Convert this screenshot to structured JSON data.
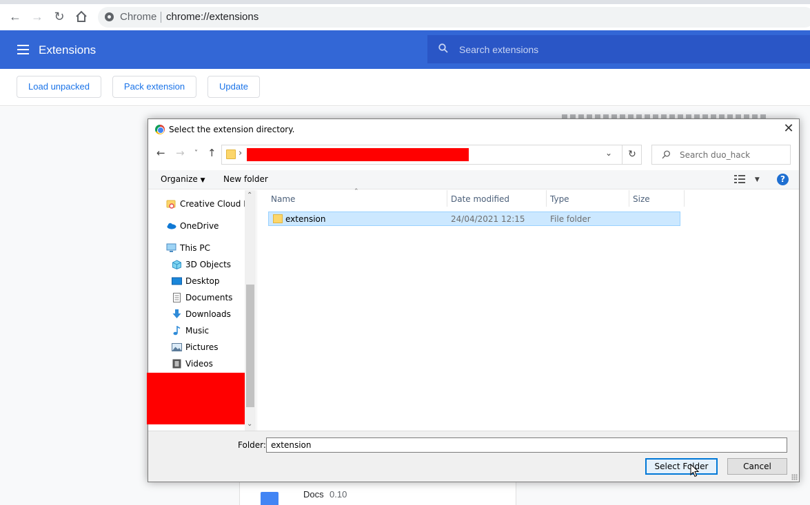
{
  "chrome": {
    "site_chip": "Chrome",
    "url": "chrome://extensions"
  },
  "extensions_page": {
    "title": "Extensions",
    "search_placeholder": "Search extensions",
    "actions": {
      "load_unpacked": "Load unpacked",
      "pack_extension": "Pack extension",
      "update": "Update"
    },
    "card": {
      "name": "Docs",
      "version": "0.10"
    }
  },
  "dialog": {
    "title": "Select the extension directory.",
    "search_placeholder": "Search duo_hack",
    "toolbar": {
      "organize": "Organize",
      "new_folder": "New folder"
    },
    "nav_items": [
      {
        "label": "Creative Cloud Fil",
        "icon": "creative-cloud-icon"
      },
      {
        "label": "OneDrive",
        "icon": "onedrive-icon"
      },
      {
        "label": "This PC",
        "icon": "computer-icon"
      },
      {
        "label": "3D Objects",
        "icon": "cube-icon"
      },
      {
        "label": "Desktop",
        "icon": "desktop-icon"
      },
      {
        "label": "Documents",
        "icon": "document-icon"
      },
      {
        "label": "Downloads",
        "icon": "download-icon"
      },
      {
        "label": "Music",
        "icon": "music-note-icon"
      },
      {
        "label": "Pictures",
        "icon": "picture-icon"
      },
      {
        "label": "Videos",
        "icon": "video-icon"
      }
    ],
    "columns": {
      "name": "Name",
      "date_modified": "Date modified",
      "type": "Type",
      "size": "Size"
    },
    "rows": [
      {
        "name": "extension",
        "date_modified": "24/04/2021 12:15",
        "type": "File folder",
        "size": ""
      }
    ],
    "folder_label": "Folder:",
    "folder_value": "extension",
    "buttons": {
      "select_folder": "Select Folder",
      "cancel": "Cancel"
    }
  },
  "colors": {
    "header_blue": "#3367d6",
    "search_blue": "#2a56c6",
    "selection": "#cce8ff",
    "redaction": "#ff0000"
  }
}
